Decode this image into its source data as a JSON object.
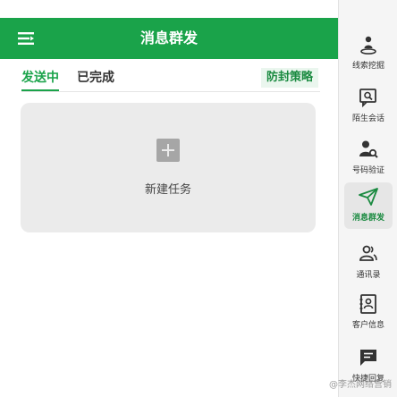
{
  "header": {
    "title": "消息群发",
    "menu_icon": "menu-icon"
  },
  "tabs": [
    {
      "label": "发送中",
      "active": true
    },
    {
      "label": "已完成",
      "active": false
    }
  ],
  "strategy_label": "防封策略",
  "new_task_label": "新建任务",
  "sidebar": {
    "items": [
      {
        "label": "线索挖掘",
        "icon": "person-pin-icon"
      },
      {
        "label": "陌生会话",
        "icon": "search-chat-icon"
      },
      {
        "label": "号码验证",
        "icon": "person-search-icon"
      },
      {
        "label": "消息群发",
        "icon": "send-icon",
        "active": true
      },
      {
        "label": "通讯录",
        "icon": "contacts-icon"
      },
      {
        "label": "客户信息",
        "icon": "contact-card-icon"
      },
      {
        "label": "快捷回复",
        "icon": "quick-reply-icon"
      }
    ]
  },
  "watermark": "@李杰网络营销",
  "colors": {
    "brand": "#1aa34a",
    "card": "#ebebeb",
    "sidebar": "#f5f5f5"
  }
}
